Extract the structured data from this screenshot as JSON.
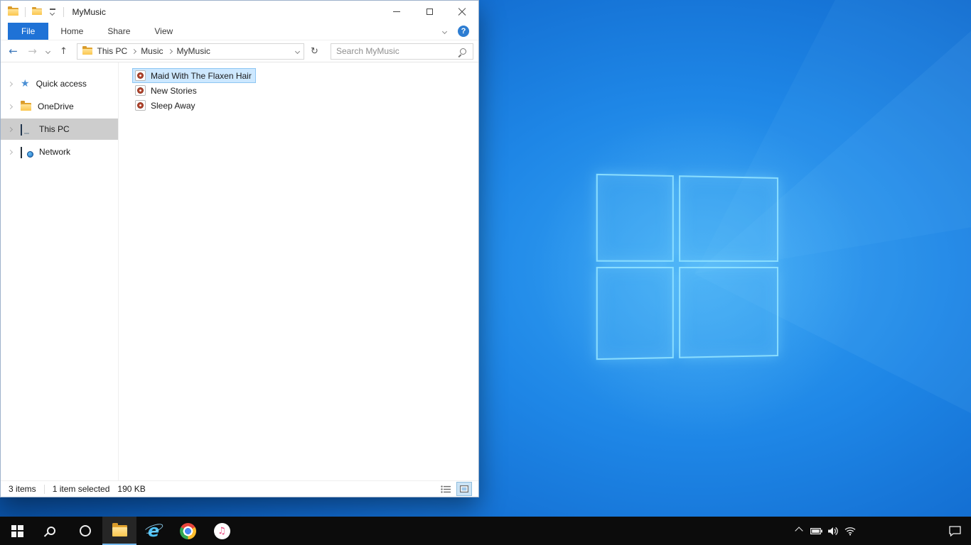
{
  "colors": {
    "accent": "#1f72d6",
    "selection_bg": "#cde8ff",
    "selection_border": "#8ec6f2",
    "taskbar_bg": "#0c0c0c",
    "desktop_blue": "#1e86e6",
    "sidebar_selected_bg": "#cdcdcd"
  },
  "window": {
    "title": "MyMusic",
    "ribbon": {
      "tabs": [
        {
          "label": "File",
          "active": true
        },
        {
          "label": "Home",
          "active": false
        },
        {
          "label": "Share",
          "active": false
        },
        {
          "label": "View",
          "active": false
        }
      ]
    },
    "address_bar": {
      "breadcrumbs": [
        "This PC",
        "Music",
        "MyMusic"
      ]
    },
    "search": {
      "placeholder": "Search MyMusic"
    },
    "sidebar": {
      "items": [
        {
          "label": "Quick access",
          "icon": "star",
          "selected": false
        },
        {
          "label": "OneDrive",
          "icon": "folder",
          "selected": false
        },
        {
          "label": "This PC",
          "icon": "computer",
          "selected": true
        },
        {
          "label": "Network",
          "icon": "network",
          "selected": false
        }
      ]
    },
    "files": [
      {
        "name": "Maid With The Flaxen Hair",
        "icon": "music-file",
        "selected": true
      },
      {
        "name": "New Stories",
        "icon": "music-file",
        "selected": false
      },
      {
        "name": "Sleep Away",
        "icon": "music-file",
        "selected": false
      }
    ],
    "status_bar": {
      "items_count": "3 items",
      "selected_count": "1 item selected",
      "selected_size": "190 KB"
    }
  },
  "icons": {
    "star": "★",
    "music_note": "♫",
    "back_arrow": "←",
    "forward_arrow": "→",
    "up_arrow": "↑",
    "refresh": "↻",
    "help": "?",
    "ie_letter": "e"
  },
  "taskbar": {
    "items": [
      {
        "name": "start"
      },
      {
        "name": "search"
      },
      {
        "name": "cortana"
      },
      {
        "name": "file-explorer",
        "active": true
      },
      {
        "name": "internet-explorer"
      },
      {
        "name": "chrome"
      },
      {
        "name": "itunes"
      }
    ],
    "tray": [
      "chevron-up",
      "battery",
      "volume",
      "network",
      "action-center"
    ]
  }
}
